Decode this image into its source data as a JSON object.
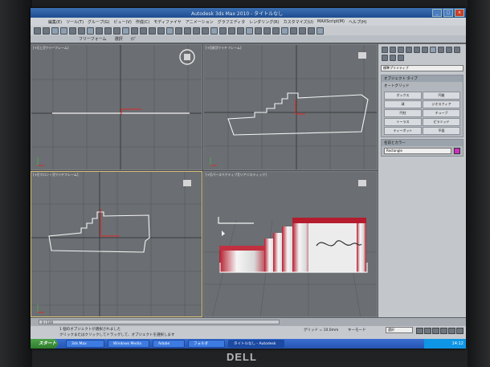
{
  "window": {
    "title": "Autodesk 3ds Max 2010 - タイトルなし"
  },
  "menu": [
    "編集(E)",
    "ツール(T)",
    "グループ(G)",
    "ビュー(V)",
    "作成(C)",
    "モディファイヤ",
    "アニメーション",
    "グラフエディタ",
    "レンダリング(R)",
    "カスタマイズ(U)",
    "MAXScript(M)",
    "ヘルプ(H)"
  ],
  "toolbar2": {
    "pane1": "フリーフォーム",
    "pane2": "選択",
    "pane3": "ｵﾌﾞ"
  },
  "viewports": [
    {
      "label": "[+][上][ワイヤフレーム]"
    },
    {
      "label": "[+][前][ワイヤフレーム]"
    },
    {
      "label": "[+][フロント][ワイヤフレーム]"
    },
    {
      "label": "[+][パースペクティブ][リアリスティック]"
    }
  ],
  "command_panel": {
    "dropdown": "標準プリミティブ",
    "object_type_header": "オブジェクト タイプ",
    "autogrid": "オートグリッド",
    "buttons": [
      "ボックス",
      "円錐",
      "球",
      "ジオスフィア",
      "円柱",
      "チューブ",
      "トーラス",
      "ピラミッド",
      "ティーポット",
      "平面"
    ],
    "name_color_header": "名前とカラー",
    "name_value": "Rectangle",
    "color": "#d030c0"
  },
  "timeline": {
    "frame": "0 / 100"
  },
  "status": {
    "line1": "1 個のオブジェクトが選択されました",
    "line2": "クリックまたはクリックしてドラッグして、オブジェクトを選択します",
    "grid": "グリッド = 10.0mm",
    "key_mode": "キーモード",
    "selection": "選択"
  },
  "taskbar": {
    "start": "スタート",
    "items": [
      "3ds Max",
      "Windows Media",
      "Adobe",
      "フォルダ",
      "タイトルなし - Autodesk"
    ],
    "clock": "14:12"
  },
  "brand": "DELL"
}
